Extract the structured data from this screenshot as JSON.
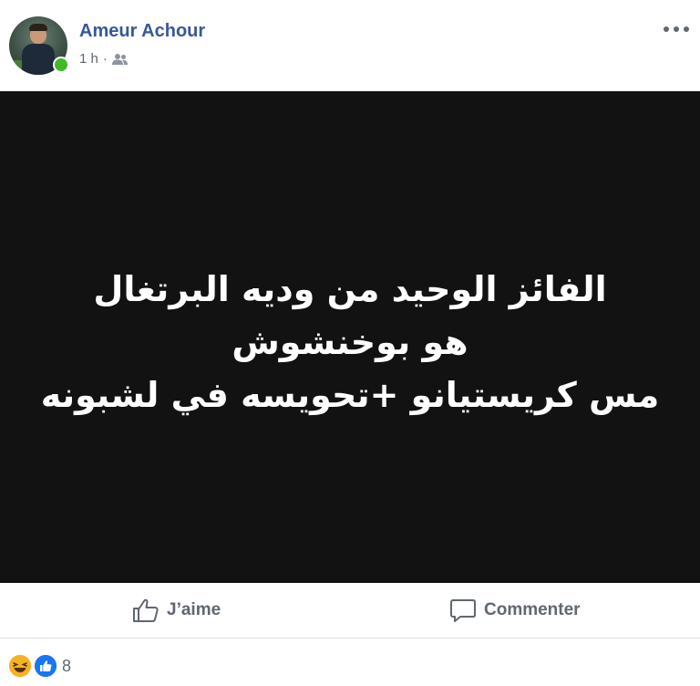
{
  "post": {
    "author": "Ameur Achour",
    "time": "1 h",
    "separator": "·",
    "privacy_icon": "friends-icon",
    "online": true,
    "more_icon": "more-dots-icon"
  },
  "image_text": {
    "line1": "الفائز الوحيد من وديه البرتغال",
    "line2": "هو بوخنشوش",
    "line3": "مس كريستيانو +تحويسه في لشبونه"
  },
  "actions": {
    "like_label": "J’aime",
    "comment_label": "Commenter"
  },
  "reactions": {
    "icons": [
      "haha-reaction-icon",
      "like-reaction-icon"
    ],
    "count": "8"
  },
  "colors": {
    "author_link": "#385898",
    "secondary_text": "#606770",
    "image_background": "#121212",
    "online_green": "#42b72a",
    "like_blue": "#1877f2",
    "haha_yellow": "#f7b125"
  }
}
